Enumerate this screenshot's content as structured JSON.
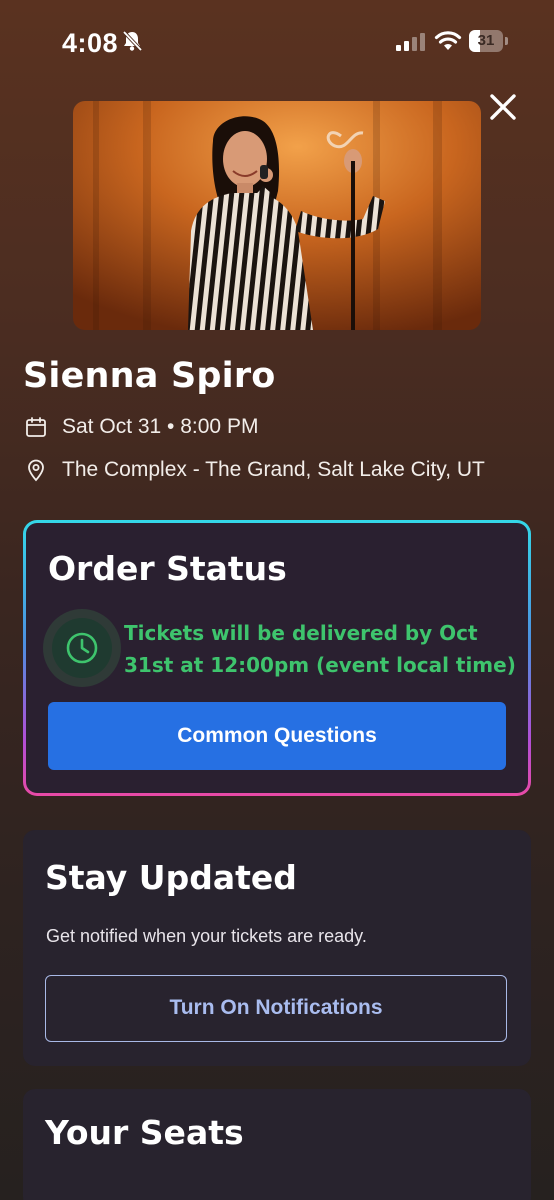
{
  "status_bar": {
    "time": "4:08",
    "battery_percent": "31",
    "battery_level": 0.31
  },
  "event": {
    "title": "Sienna Spiro",
    "date": "Sat Oct 31 • 8:00 PM",
    "venue": "The Complex - The Grand, Salt Lake City, UT"
  },
  "order_status": {
    "heading": "Order Status",
    "message": "Tickets will be delivered by Oct 31st at 12:00pm (event local time)",
    "button_label": "Common Questions"
  },
  "stay_updated": {
    "heading": "Stay Updated",
    "description": "Get notified when your tickets are ready.",
    "button_label": "Turn On Notifications"
  },
  "your_seats": {
    "heading": "Your Seats"
  },
  "icons": {
    "close": "close-icon",
    "calendar": "calendar-icon",
    "location": "location-pin-icon",
    "clock": "clock-icon"
  },
  "colors": {
    "accent_blue": "#2670e3",
    "status_green": "#3ec46d",
    "outline_button": "#a9bcef",
    "card_background": "#28232e"
  }
}
